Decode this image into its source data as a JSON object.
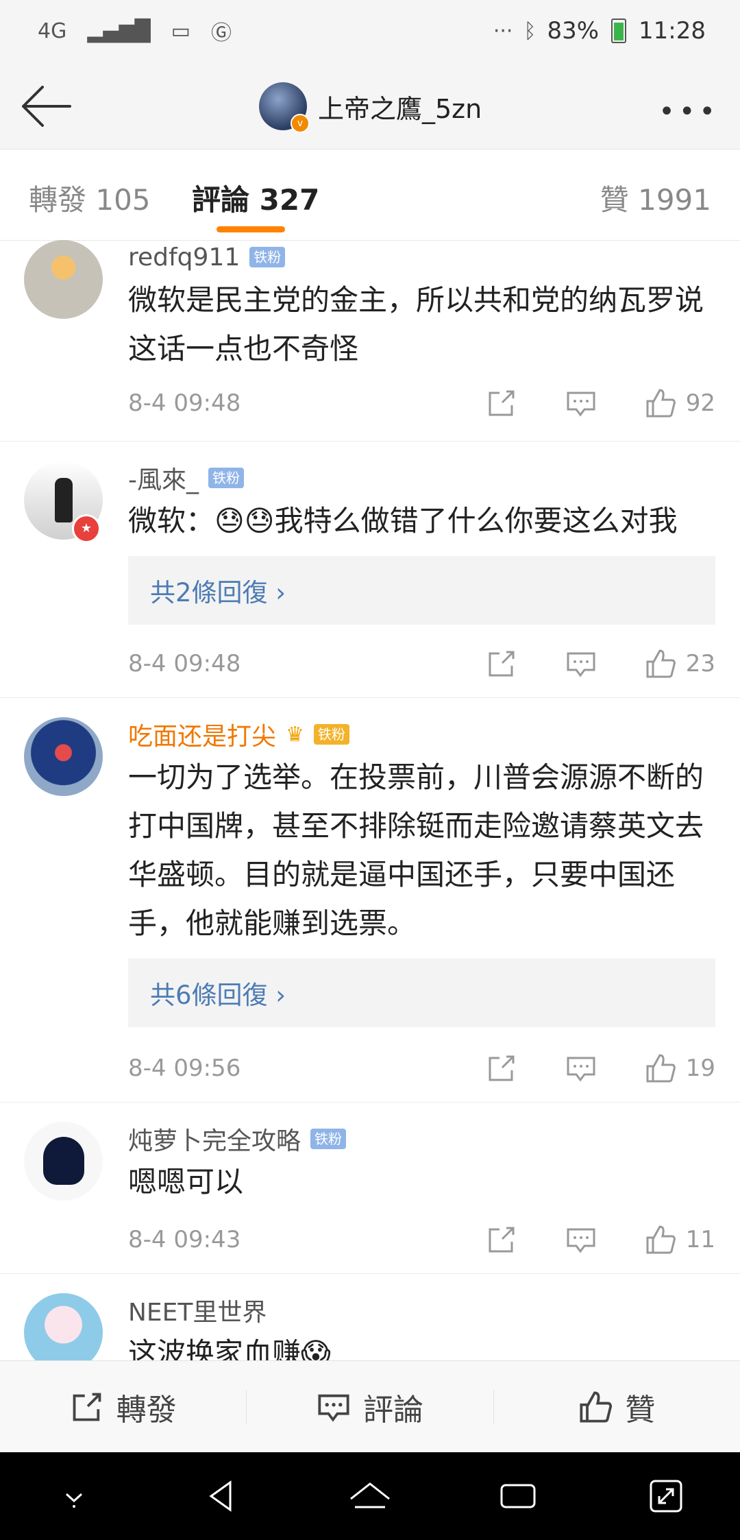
{
  "status_bar": {
    "network": "4G",
    "battery": "83%",
    "time": "11:28",
    "icons": [
      "signal-icon",
      "image-icon",
      "go-icon",
      "more-dots-icon",
      "bluetooth-icon",
      "battery-icon"
    ]
  },
  "header": {
    "user_name": "上帝之鷹_5zn",
    "verified_badge": "v"
  },
  "tabs": {
    "repost": "轉發 105",
    "comments": "評論 327",
    "likes": "贊 1991"
  },
  "comments": [
    {
      "name": "redfq911",
      "badge": "铁粉",
      "text": "微软是民主党的金主，所以共和党的纳瓦罗说这话一点也不奇怪",
      "time": "8-4 09:48",
      "likes": "92"
    },
    {
      "name": "-風來_",
      "badge": "铁粉",
      "text": "微软：😓😓我特么做错了什么你要这么对我",
      "reply": "共2條回復 ›",
      "time": "8-4 09:48",
      "likes": "23"
    },
    {
      "name": "吃面还是打尖",
      "badge": "铁粉",
      "crown": "♛",
      "text": "一切为了选举。在投票前，川普会源源不断的打中国牌，甚至不排除铤而走险邀请蔡英文去华盛顿。目的就是逼中国还手，只要中国还手，他就能赚到选票。",
      "reply": "共6條回復 ›",
      "time": "8-4 09:56",
      "likes": "19"
    },
    {
      "name": "炖萝卜完全攻略",
      "badge": "铁粉",
      "text": "嗯嗯可以",
      "time": "8-4 09:43",
      "likes": "11"
    },
    {
      "name": "NEET里世界",
      "text": "这波换家血赚😱"
    }
  ],
  "bottom_bar": {
    "repost": "轉發",
    "comment": "評論",
    "like": "贊"
  },
  "colors": {
    "accent": "#ff8200",
    "link": "#4c7bb4",
    "vip_name": "#f07800"
  }
}
